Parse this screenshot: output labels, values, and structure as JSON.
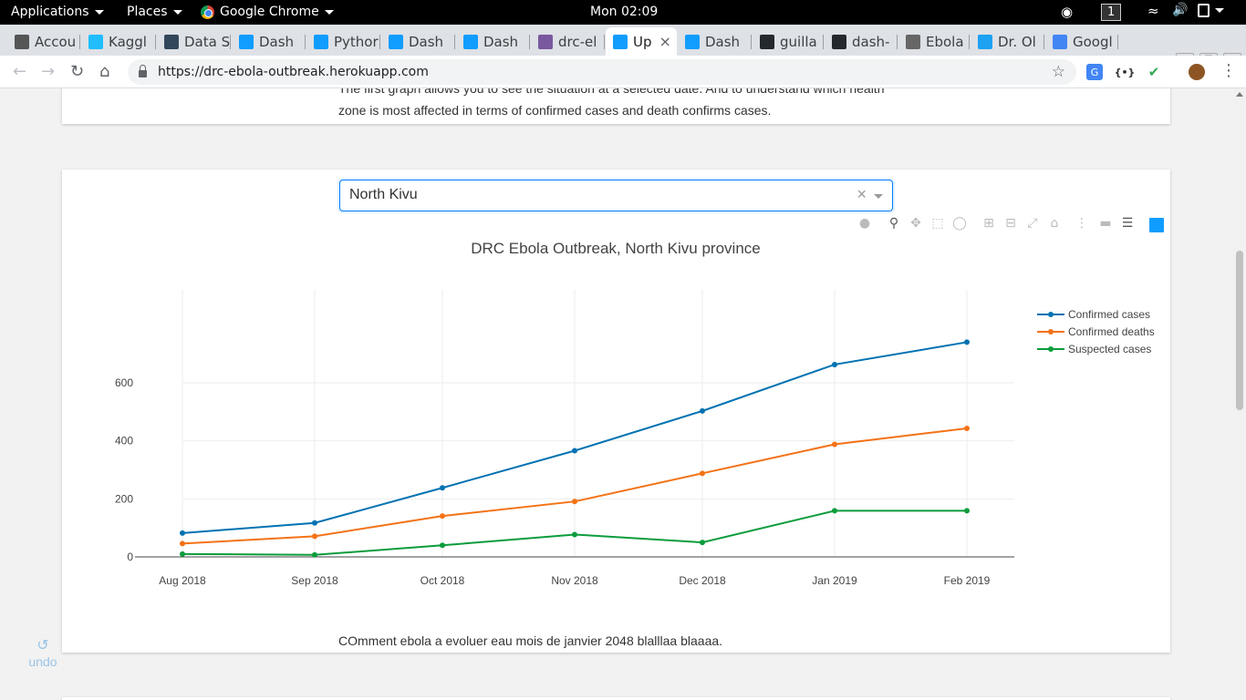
{
  "topbar": {
    "applications": "Applications",
    "places": "Places",
    "app_name": "Google Chrome",
    "clock": "Mon 02:09",
    "workspace": "1"
  },
  "tabs": [
    {
      "label": "Accou",
      "icon": "brain-icon",
      "color": "#555555"
    },
    {
      "label": "Kaggl",
      "icon": "kaggle-icon",
      "color": "#20beff"
    },
    {
      "label": "Data S",
      "icon": "datacamp-icon",
      "color": "#33475b"
    },
    {
      "label": "Dash",
      "icon": "dash-icon",
      "color": "#119dff"
    },
    {
      "label": "Pythor",
      "icon": "plotly-icon",
      "color": "#119dff"
    },
    {
      "label": "Dash",
      "icon": "dash-icon",
      "color": "#119dff"
    },
    {
      "label": "Dash",
      "icon": "dash-icon",
      "color": "#119dff"
    },
    {
      "label": "drc-el",
      "icon": "heroku-icon",
      "color": "#79589f"
    },
    {
      "label": "Up",
      "icon": "dash-icon",
      "color": "#119dff",
      "active": true
    },
    {
      "label": "Dash",
      "icon": "dash-icon",
      "color": "#119dff"
    },
    {
      "label": "guilla",
      "icon": "github-icon",
      "color": "#24292e"
    },
    {
      "label": "dash-",
      "icon": "github-icon",
      "color": "#24292e"
    },
    {
      "label": "Ebola",
      "icon": "network-icon",
      "color": "#666666"
    },
    {
      "label": "Dr. Ol",
      "icon": "twitter-icon",
      "color": "#1da1f2"
    },
    {
      "label": "Googl",
      "icon": "google-translate-icon",
      "color": "#4285f4"
    }
  ],
  "address_bar": {
    "url": "https://drc-ebola-outbreak.herokuapp.com"
  },
  "page": {
    "intro_line1": "The first graph allows you to see the situation at a selected date. And to understand which health",
    "intro_line2": "zone is most affected in terms of confirmed cases and death confirms cases.",
    "dropdown_value": "North Kivu",
    "comment": "COmment ebola a evoluer eau mois de janvier 2048 blalllaa blaaaa.",
    "undo_label": "undo"
  },
  "chart_data": {
    "type": "line",
    "title": "DRC Ebola Outbreak, North Kivu province",
    "categories": [
      "Aug 2018",
      "Sep 2018",
      "Oct 2018",
      "Nov 2018",
      "Dec 2018",
      "Jan 2019",
      "Feb 2019"
    ],
    "y_ticks": [
      0,
      200,
      400,
      600
    ],
    "ylim": [
      -5,
      800
    ],
    "grid": true,
    "legend_position": "right",
    "series": [
      {
        "name": "Confirmed cases",
        "color": "#0072b2",
        "values": [
          82,
          117,
          238,
          366,
          503,
          663,
          740
        ]
      },
      {
        "name": "Confirmed deaths",
        "color": "#f47216",
        "values": [
          46,
          71,
          141,
          191,
          288,
          388,
          443
        ]
      },
      {
        "name": "Suspected cases",
        "color": "#0c9c3c",
        "values": [
          10,
          7,
          40,
          77,
          50,
          159,
          159
        ]
      }
    ]
  }
}
